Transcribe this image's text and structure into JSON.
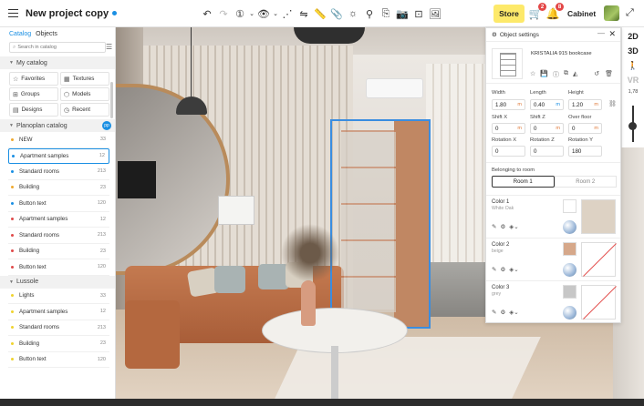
{
  "topbar": {
    "title": "New project copy",
    "store_label": "Store",
    "cart_badge": "2",
    "notif_badge": "8",
    "cabinet_label": "Cabinet"
  },
  "catalog": {
    "tabs": [
      "Catalog",
      "Objects"
    ],
    "search_placeholder": "Search in catalog",
    "my_catalog": {
      "title": "My catalog",
      "cards": [
        "Favorites",
        "Textures",
        "Groups",
        "Models",
        "Designs",
        "Recent"
      ]
    },
    "planoplan": {
      "title": "Planoplan catalog",
      "items": [
        {
          "label": "NEW",
          "count": "33",
          "color": "#f0a92f"
        },
        {
          "label": "Apartment samples",
          "count": "12",
          "color": "#1a8fe3"
        },
        {
          "label": "Standard rooms",
          "count": "213",
          "color": "#1a8fe3"
        },
        {
          "label": "Building",
          "count": "23",
          "color": "#f0a92f"
        },
        {
          "label": "Button text",
          "count": "120",
          "color": "#1a8fe3"
        },
        {
          "label": "Apartment samples",
          "count": "12",
          "color": "#e04a4a"
        },
        {
          "label": "Standard rooms",
          "count": "213",
          "color": "#e04a4a"
        },
        {
          "label": "Building",
          "count": "23",
          "color": "#e04a4a"
        },
        {
          "label": "Button text",
          "count": "120",
          "color": "#e04a4a"
        }
      ]
    },
    "lussole": {
      "title": "Lussole",
      "items": [
        {
          "label": "Lights",
          "count": "33",
          "color": "#f0d32f"
        },
        {
          "label": "Apartment samples",
          "count": "12",
          "color": "#f0d32f"
        },
        {
          "label": "Standard rooms",
          "count": "213",
          "color": "#f0d32f"
        },
        {
          "label": "Building",
          "count": "23",
          "color": "#f0d32f"
        },
        {
          "label": "Button text",
          "count": "120",
          "color": "#f0d32f"
        }
      ]
    }
  },
  "view_controls": {
    "mode_2d": "2D",
    "mode_3d": "3D",
    "mode_vr": "VR",
    "zoom": "1,78"
  },
  "object_settings": {
    "title": "Object settings",
    "object_name": "KRISTALIA 915 bookcase",
    "fields": {
      "width_label": "Width",
      "width": "1.80",
      "width_unit": "m",
      "length_label": "Length",
      "length": "0.40",
      "length_unit": "m",
      "height_label": "Height",
      "height": "1.20",
      "height_unit": "m",
      "shiftx_label": "Shift X",
      "shiftx": "0",
      "shiftx_unit": "m",
      "shiftz_label": "Shift Z",
      "shiftz": "0",
      "shiftz_unit": "m",
      "overfloor_label": "Over floor",
      "overfloor": "0",
      "overfloor_unit": "m",
      "rotx_label": "Rotation X",
      "rotx": "0",
      "rotz_label": "Rotation Z",
      "rotz": "0",
      "roty_label": "Rotation Y",
      "roty": "180"
    },
    "room_label": "Belonging to room",
    "rooms": [
      "Room 1",
      "Room 2"
    ],
    "colors": [
      {
        "name": "Color 1",
        "sub": "White Oak",
        "swatch": "#ffffff",
        "big": "#ddd2c4",
        "none": false
      },
      {
        "name": "Color 2",
        "sub": "beige",
        "swatch": "#d6a88a",
        "big": "#ffffff",
        "none": true
      },
      {
        "name": "Color 3",
        "sub": "grey",
        "swatch": "#c7c7c7",
        "big": "#ffffff",
        "none": true
      }
    ]
  }
}
